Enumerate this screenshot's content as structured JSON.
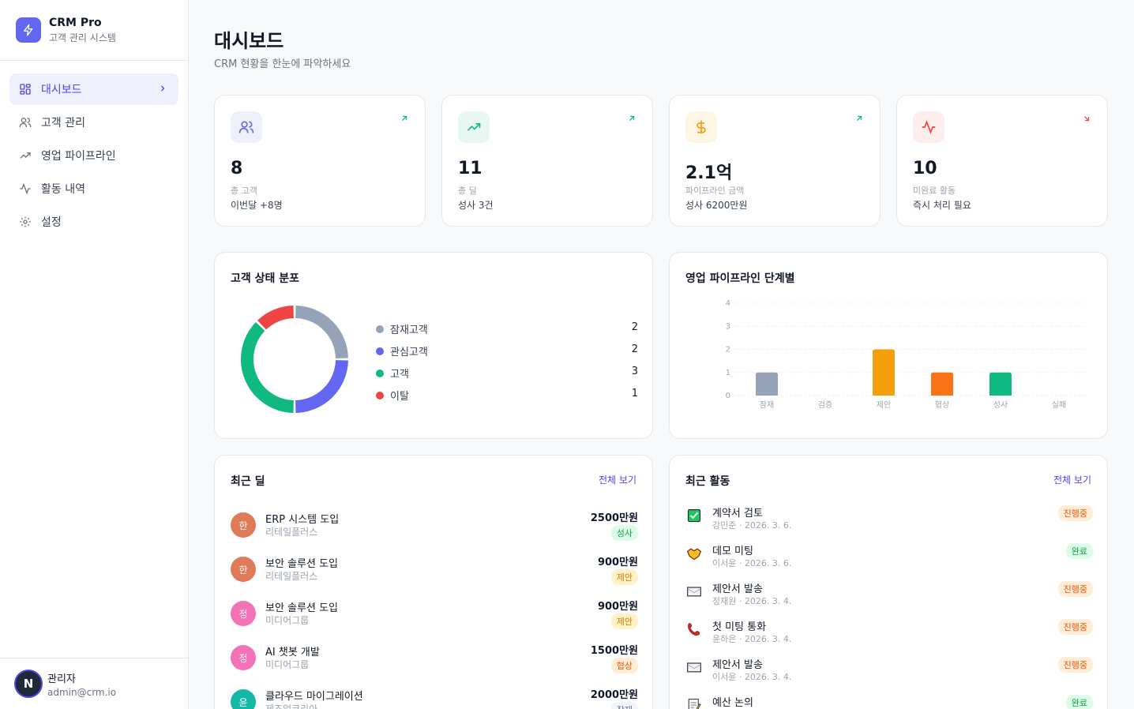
{
  "brand": {
    "name": "CRM Pro",
    "subtitle": "고객 관리 시스템"
  },
  "nav": [
    {
      "label": "대시보드",
      "icon": "grid-icon",
      "active": true
    },
    {
      "label": "고객 관리",
      "icon": "users-icon"
    },
    {
      "label": "영업 파이프라인",
      "icon": "trend-icon"
    },
    {
      "label": "활동 내역",
      "icon": "activity-icon"
    },
    {
      "label": "설정",
      "icon": "gear-icon"
    }
  ],
  "user": {
    "initial": "N",
    "name": "관리자",
    "email": "admin@crm.io"
  },
  "page": {
    "title": "대시보드",
    "subtitle": "CRM 현황을 한눈에 파악하세요"
  },
  "stats": [
    {
      "value": "8",
      "label": "총 고객",
      "note": "이번달 +8명",
      "icon": "users-icon",
      "trend": "up",
      "color": "#6366f1",
      "bg": "#eef0fb"
    },
    {
      "value": "11",
      "label": "총 딜",
      "note": "성사 3건",
      "icon": "trend-up-icon",
      "trend": "up",
      "color": "#10b981",
      "bg": "#e8f8f1"
    },
    {
      "value": "2.1억",
      "label": "파이프라인 금액",
      "note": "성사 6200만원",
      "icon": "dollar-icon",
      "trend": "up",
      "color": "#f59e0b",
      "bg": "#fef6e4"
    },
    {
      "value": "10",
      "label": "미완료 활동",
      "note": "즉시 처리 필요",
      "icon": "activity-icon",
      "trend": "down",
      "color": "#ef4444",
      "bg": "#fdeeee"
    }
  ],
  "status_card": {
    "title": "고객 상태 분포",
    "legend": [
      {
        "name": "잠재고객",
        "count": "2",
        "color": "#94a3b8"
      },
      {
        "name": "관심고객",
        "count": "2",
        "color": "#6366f1"
      },
      {
        "name": "고객",
        "count": "3",
        "color": "#10b981"
      },
      {
        "name": "이탈",
        "count": "1",
        "color": "#ef4444"
      }
    ]
  },
  "pipeline_card": {
    "title": "영업 파이프라인 단계별"
  },
  "chart_data": {
    "type": "bar",
    "categories": [
      "잠재",
      "검증",
      "제안",
      "협상",
      "성사",
      "실패"
    ],
    "values": [
      1,
      0,
      2,
      1,
      1,
      0
    ],
    "colors": [
      "#94a3b8",
      "#8b5cf6",
      "#f59e0b",
      "#f97316",
      "#10b981",
      "#ef4444"
    ],
    "yticks": [
      "0",
      "1",
      "2",
      "3",
      "4"
    ],
    "ylim": [
      0,
      4
    ],
    "grid": true
  },
  "deals_card": {
    "title": "최근 딜",
    "link": "전체 보기",
    "items": [
      {
        "initial": "한",
        "name": "ERP 시스템 도입",
        "company": "리테일플러스",
        "amount": "2500만원",
        "status": "성사",
        "avatar": "#e07b5a",
        "badge_bg": "#dcfce7",
        "badge_fg": "#16a34a"
      },
      {
        "initial": "한",
        "name": "보안 솔루션 도입",
        "company": "리테일플러스",
        "amount": "900만원",
        "status": "제안",
        "avatar": "#e07b5a",
        "badge_bg": "#fef3c7",
        "badge_fg": "#d97706"
      },
      {
        "initial": "정",
        "name": "보안 솔루션 도입",
        "company": "미디어그룹",
        "amount": "900만원",
        "status": "제안",
        "avatar": "#f472b6",
        "badge_bg": "#fef3c7",
        "badge_fg": "#d97706"
      },
      {
        "initial": "정",
        "name": "AI 챗봇 개발",
        "company": "미디어그룹",
        "amount": "1500만원",
        "status": "협상",
        "avatar": "#f472b6",
        "badge_bg": "#ffedd5",
        "badge_fg": "#ea580c"
      },
      {
        "initial": "윤",
        "name": "클라우드 마이그레이션",
        "company": "제조업코리아",
        "amount": "2000만원",
        "status": "잠재",
        "avatar": "#14b8a6",
        "badge_bg": "#f1f5f9",
        "badge_fg": "#64748b"
      }
    ]
  },
  "activities_card": {
    "title": "최근 활동",
    "link": "전체 보기",
    "items": [
      {
        "title": "계약서 검토",
        "meta": "강민준 · 2026. 3. 6.",
        "status": "진행중",
        "icon": "checkbox-icon",
        "done": false
      },
      {
        "title": "데모 미팅",
        "meta": "이서윤 · 2026. 3. 6.",
        "status": "완료",
        "icon": "handshake-icon",
        "done": true
      },
      {
        "title": "제안서 발송",
        "meta": "정재원 · 2026. 3. 4.",
        "status": "진행중",
        "icon": "envelope-icon",
        "done": false
      },
      {
        "title": "첫 미팅 통화",
        "meta": "윤하은 · 2026. 3. 4.",
        "status": "진행중",
        "icon": "phone-icon",
        "done": false
      },
      {
        "title": "제안서 발송",
        "meta": "이서윤 · 2026. 3. 4.",
        "status": "진행중",
        "icon": "envelope-icon",
        "done": false
      },
      {
        "title": "예산 논의",
        "meta": "",
        "status": "완료",
        "icon": "memo-icon",
        "done": true
      }
    ]
  }
}
